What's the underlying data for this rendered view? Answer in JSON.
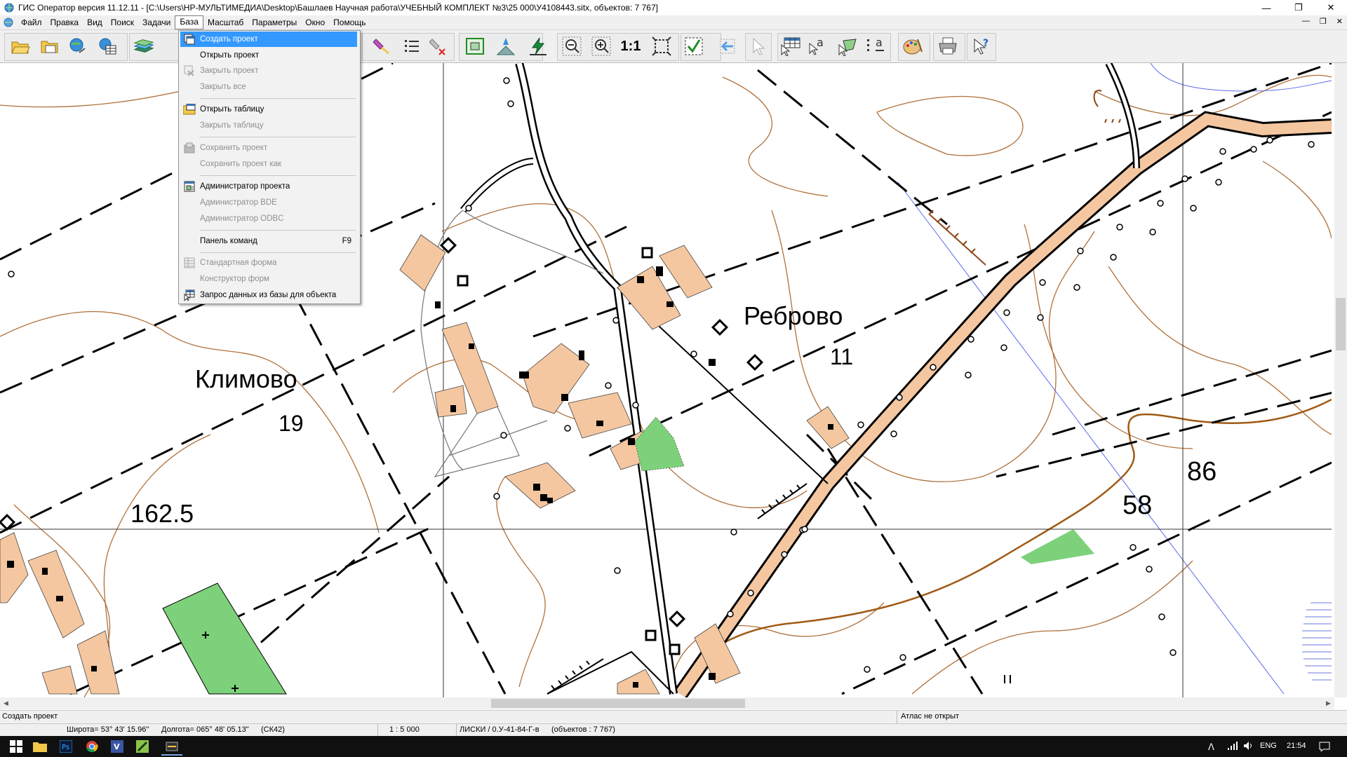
{
  "titlebar": {
    "title": "ГИС Оператор версия 11.12.11 - [C:\\Users\\HP-МУЛЬТИМЕДИА\\Desktop\\Башлаев Научная работа\\УЧЕБНЫЙ КОМПЛЕКТ №3\\25 000\\У4108443.sitx, объектов: 7 767]",
    "minimize": "—",
    "restore": "❐",
    "close": "✕"
  },
  "menubar": {
    "items": [
      "Файл",
      "Правка",
      "Вид",
      "Поиск",
      "Задачи",
      "База",
      "Масштаб",
      "Параметры",
      "Окно",
      "Помощь"
    ],
    "mdi_minimize": "—",
    "mdi_restore": "❐",
    "mdi_close": "✕"
  },
  "toolbar": {
    "scale_button": "1:1"
  },
  "base_menu": {
    "items": [
      {
        "label": "Создать проект",
        "enabled": true,
        "highlighted": true,
        "icon": "create-project-icon"
      },
      {
        "label": "Открыть проект",
        "enabled": true,
        "icon": ""
      },
      {
        "label": "Закрыть проект",
        "enabled": false,
        "icon": "close-project-icon"
      },
      {
        "label": "Закрыть все",
        "enabled": false,
        "icon": ""
      },
      {
        "label": "Открыть таблицу",
        "enabled": true,
        "icon": "open-table-icon"
      },
      {
        "label": "Закрыть таблицу",
        "enabled": false,
        "icon": ""
      },
      {
        "label": "Сохранить проект",
        "enabled": false,
        "icon": "save-project-icon"
      },
      {
        "label": "Сохранить проект как",
        "enabled": false,
        "icon": ""
      },
      {
        "label": "Администратор проекта",
        "enabled": true,
        "icon": "project-admin-icon"
      },
      {
        "label": "Администратор BDE",
        "enabled": false,
        "icon": ""
      },
      {
        "label": "Администратор ODBC",
        "enabled": false,
        "icon": ""
      },
      {
        "label": "Панель команд",
        "shortcut": "F9",
        "enabled": true,
        "icon": ""
      },
      {
        "label": "Стандартная форма",
        "enabled": false,
        "icon": "standard-form-icon"
      },
      {
        "label": "Конструктор форм",
        "enabled": false,
        "icon": ""
      },
      {
        "label": "Запрос данных из базы для объекта",
        "enabled": true,
        "icon": "query-data-icon"
      }
    ]
  },
  "map": {
    "labels": {
      "village1": "Климово",
      "village1_houses": "19",
      "village2": "Реброво",
      "village2_houses": "11",
      "elevation": "162.5",
      "num1": "86",
      "num2": "58"
    },
    "colors": {
      "contour": "#b0703a",
      "road_fill": "#f5c7a0",
      "building": "#f5c7a0",
      "vegetation": "#7dd17a",
      "grid": "#000000"
    }
  },
  "status": {
    "hint": "Создать проект",
    "atlas": "Атлас не открыт",
    "latitude": "Широта= 53° 43' 15.96\"",
    "longitude": "Долгота= 065° 48' 05.13\"",
    "crs": "(СК42)",
    "scale": "1 : 5 000",
    "sheet": "ЛИСКИ / 0.У-41-84-Г-в",
    "objects": "(объектов : 7 767)"
  },
  "taskbar": {
    "lang": "ENG",
    "time": "21:54"
  }
}
